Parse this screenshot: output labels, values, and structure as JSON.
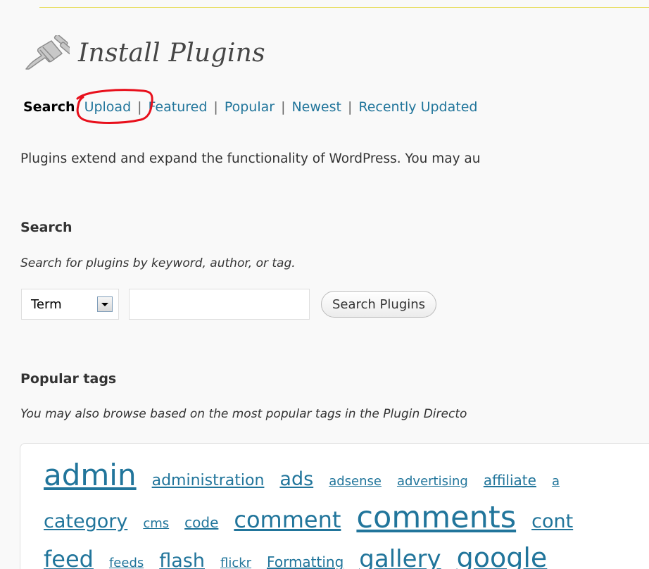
{
  "page": {
    "title": "Install Plugins",
    "intro": "Plugins extend and expand the functionality of WordPress. You may au"
  },
  "nav": {
    "current": "Search",
    "links": [
      "Upload",
      "Featured",
      "Popular",
      "Newest",
      "Recently Updated"
    ],
    "separator": "|",
    "annotation": "red hand-drawn circle around Upload"
  },
  "search": {
    "heading": "Search",
    "description": "Search for plugins by keyword, author, or tag.",
    "select_value": "Term",
    "input_value": "",
    "button": "Search Plugins"
  },
  "popular_tags": {
    "heading": "Popular tags",
    "description": "You may also browse based on the most popular tags in the Plugin Directo",
    "rows": [
      [
        {
          "label": "admin",
          "size": 42
        },
        {
          "label": "administration",
          "size": 22
        },
        {
          "label": "ads",
          "size": 27
        },
        {
          "label": "adsense",
          "size": 18
        },
        {
          "label": "advertising",
          "size": 18
        },
        {
          "label": "affiliate",
          "size": 20
        },
        {
          "label": "a",
          "size": 18
        }
      ],
      [
        {
          "label": "category",
          "size": 27
        },
        {
          "label": "cms",
          "size": 18
        },
        {
          "label": "code",
          "size": 20
        },
        {
          "label": "comment",
          "size": 32
        },
        {
          "label": "comments",
          "size": 43
        },
        {
          "label": "cont",
          "size": 27
        }
      ],
      [
        {
          "label": "feed",
          "size": 32
        },
        {
          "label": "feeds",
          "size": 18
        },
        {
          "label": "flash",
          "size": 27
        },
        {
          "label": "flickr",
          "size": 18
        },
        {
          "label": "Formatting",
          "size": 20
        },
        {
          "label": "gallery",
          "size": 34
        },
        {
          "label": "google",
          "size": 38
        }
      ]
    ]
  },
  "colors": {
    "link": "#21759b",
    "background": "#f9f9f9",
    "annotation": "#e8101c",
    "top_rule": "#e6db55"
  },
  "icons": {
    "title_icon": "plug-icon",
    "select_arrow": "chevron-down-icon"
  }
}
